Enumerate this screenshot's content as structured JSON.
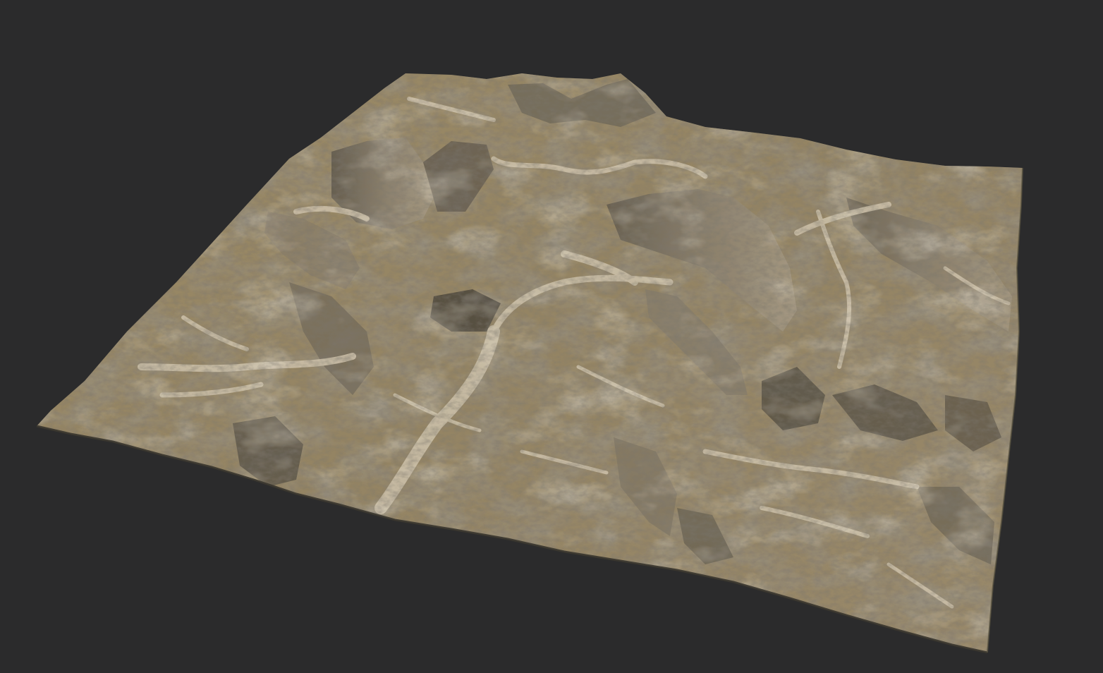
{
  "viewport": {
    "background_color": "#2b2b2c"
  },
  "terrain": {
    "base_color": "#a08f6c",
    "dark_rock_color": "#4f4a42",
    "light_sediment_color": "#d8ccb4",
    "shadow_color": "#2f2c27",
    "highlight_color": "#c9baa0"
  }
}
